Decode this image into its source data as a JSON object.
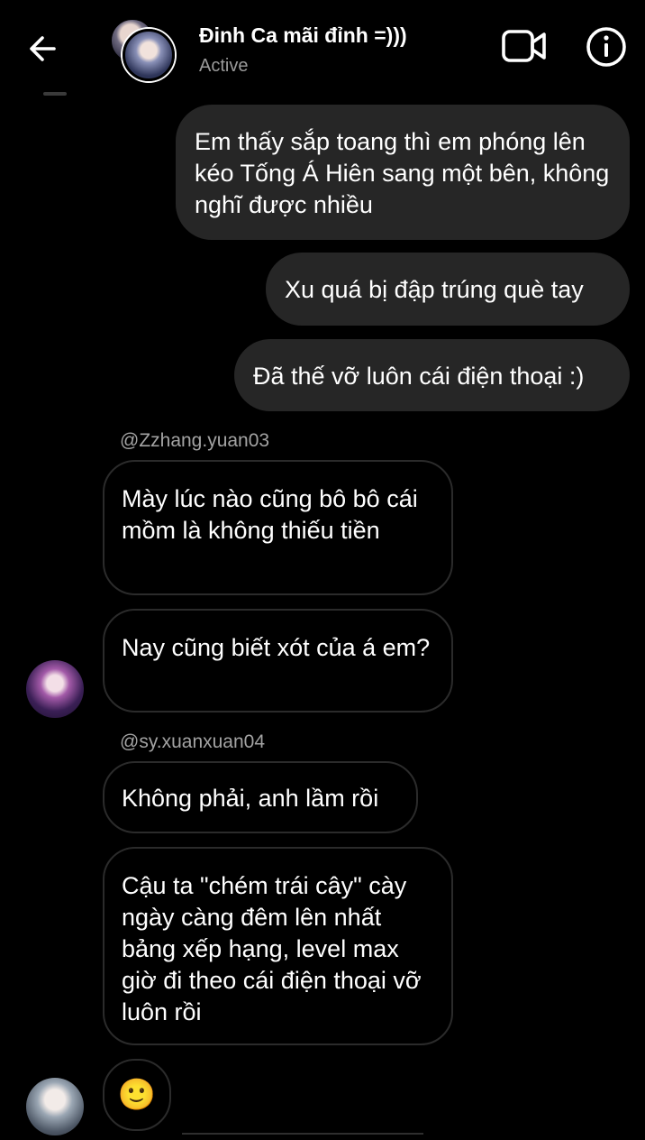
{
  "header": {
    "contact_name": "Đinh Ca mãi đỉnh =)))",
    "status": "Active",
    "icons": {
      "back": "arrow-left-icon",
      "video": "video-camera-icon",
      "info": "info-icon"
    }
  },
  "messages": {
    "sent": [
      "Em thấy sắp toang thì em phóng lên kéo Tống Á Hiên sang một bên, không nghĩ được nhiều",
      "Xu quá bị đập trúng què tay",
      "Đã thế vỡ luôn cái điện thoại :)"
    ],
    "group1": {
      "username": "@Zzhang.yuan03",
      "messages": [
        "Mày lúc nào cũng bô bô cái mồm là không thiếu tiền",
        "Nay cũng biết xót của á em?"
      ]
    },
    "group2": {
      "username": "@sy.xuanxuan04",
      "messages": [
        "Không phải, anh lầm rồi",
        "Cậu ta \"chém trái cây\" cày ngày càng đêm lên nhất bảng xếp hạng, level max giờ đi theo cái điện thoại vỡ luôn rồi"
      ]
    },
    "group3": {
      "emoji": "🙂"
    }
  }
}
